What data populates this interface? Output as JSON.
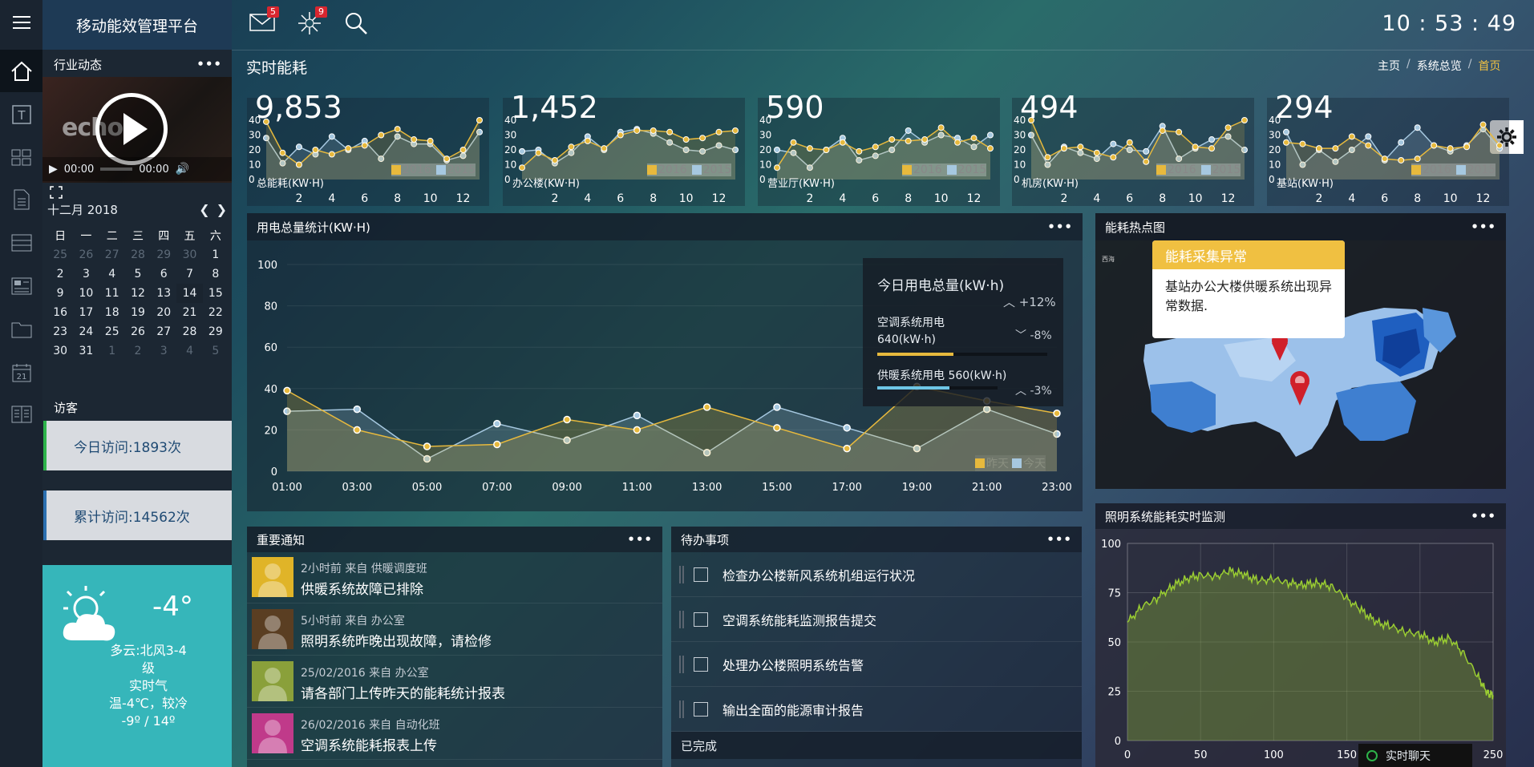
{
  "app": {
    "title": "移动能效管理平台",
    "clock": "10 : 53 : 49"
  },
  "topbar": {
    "mail_count": "5",
    "alert_count": "9"
  },
  "sidebar_icons": [
    "home-icon",
    "text-icon",
    "grid-icon",
    "document-icon",
    "inbox-icon",
    "layout-icon",
    "folder-icon",
    "calendar-icon",
    "columns-icon"
  ],
  "news": {
    "title": "行业动态",
    "more": "•••",
    "video_time": "00:00",
    "video_total": "00:00"
  },
  "calendar": {
    "month": "十二月 2018",
    "weekdays": [
      "日",
      "一",
      "二",
      "三",
      "四",
      "五",
      "六"
    ],
    "weeks": [
      [
        "25",
        "26",
        "27",
        "28",
        "29",
        "30",
        "1"
      ],
      [
        "2",
        "3",
        "4",
        "5",
        "6",
        "7",
        "8"
      ],
      [
        "9",
        "10",
        "11",
        "12",
        "13",
        "14",
        "15"
      ],
      [
        "16",
        "17",
        "18",
        "19",
        "20",
        "21",
        "22"
      ],
      [
        "23",
        "24",
        "25",
        "26",
        "27",
        "28",
        "29"
      ],
      [
        "30",
        "31",
        "1",
        "2",
        "3",
        "4",
        "5"
      ]
    ],
    "today": "14"
  },
  "visitors": {
    "title": "访客",
    "today": "今日访问:1893次",
    "total": "累计访问:14562次"
  },
  "weather": {
    "temp": "-4°",
    "desc": "多云:北风3-4级",
    "desc2": "实时气温-4℃，较冷",
    "range": "-9º / 14º"
  },
  "page": {
    "title": "实时能耗",
    "breadcrumb": [
      "主页",
      "系统总览",
      "首页"
    ]
  },
  "kpis": [
    {
      "value": "9,853",
      "label": "总能耗(KW·H)",
      "s2016": [
        39,
        18,
        10,
        20,
        17,
        21,
        23,
        30,
        34,
        27,
        26,
        14,
        20,
        40
      ],
      "s2015": [
        28,
        11,
        22,
        17,
        29,
        20,
        26,
        14,
        29,
        24,
        24,
        13,
        16,
        32
      ]
    },
    {
      "value": "1,452",
      "label": "办公楼(KW·H)",
      "s2016": [
        8,
        18,
        13,
        22,
        26,
        21,
        30,
        33,
        33,
        32,
        27,
        28,
        32,
        33
      ],
      "s2015": [
        19,
        20,
        11,
        18,
        29,
        20,
        32,
        34,
        31,
        25,
        20,
        19,
        23,
        20
      ]
    },
    {
      "value": "590",
      "label": "营业厅(KW·H)",
      "s2016": [
        8,
        25,
        21,
        20,
        25,
        19,
        22,
        27,
        26,
        27,
        35,
        25,
        28,
        21
      ],
      "s2015": [
        20,
        18,
        8,
        20,
        28,
        13,
        16,
        20,
        33,
        25,
        30,
        28,
        22,
        30
      ]
    },
    {
      "value": "494",
      "label": "机房(KW·H)",
      "s2016": [
        40,
        15,
        21,
        22,
        18,
        15,
        25,
        12,
        33,
        32,
        22,
        21,
        35,
        40
      ],
      "s2015": [
        30,
        10,
        22,
        18,
        14,
        24,
        20,
        19,
        36,
        14,
        21,
        27,
        29,
        20
      ]
    },
    {
      "value": "294",
      "label": "基站(KW·H)",
      "s2016": [
        25,
        24,
        21,
        21,
        29,
        23,
        14,
        13,
        14,
        23,
        21,
        22,
        37,
        23
      ],
      "s2015": [
        32,
        10,
        20,
        12,
        20,
        29,
        13,
        25,
        35,
        23,
        19,
        23,
        34,
        21
      ]
    }
  ],
  "kpi_legend": {
    "a": "2016",
    "b": "2015"
  },
  "kpi_axis": {
    "y": [
      "40",
      "30",
      "20",
      "10",
      "0"
    ],
    "x": [
      "2",
      "4",
      "6",
      "8",
      "10",
      "12"
    ]
  },
  "usage": {
    "title": "用电总量统计(KW·H)",
    "more": "•••",
    "summary_title": "今日用电总量(kW·h)",
    "summary_change": "+12%",
    "ac_label": "空调系统用电",
    "ac_value": "640(kW·h)",
    "ac_change": "-8%",
    "ac_progress": 0.45,
    "heat_label": "供暖系统用电 560(kW·h)",
    "heat_change": "-3%",
    "heat_progress": 0.6,
    "legend_a": "昨天",
    "legend_b": "今天"
  },
  "chart_data": [
    {
      "type": "area",
      "title": "用电总量统计(KW·H)",
      "x": [
        "01:00",
        "02:00",
        "03:00",
        "04:00",
        "05:00",
        "06:00",
        "07:00",
        "08:00",
        "09:00",
        "10:00",
        "11:00",
        "12:00",
        "13:00",
        "14:00",
        "15:00",
        "16:00",
        "17:00",
        "18:00",
        "19:00",
        "20:00",
        "21:00",
        "22:00",
        "23:00"
      ],
      "xticks": [
        "01:00",
        "03:00",
        "05:00",
        "07:00",
        "09:00",
        "11:00",
        "13:00",
        "15:00",
        "17:00",
        "19:00",
        "21:00",
        "23:00"
      ],
      "ylim": [
        0,
        100
      ],
      "yticks": [
        0,
        20,
        40,
        60,
        80,
        100
      ],
      "series": [
        {
          "name": "昨天",
          "color": "#e7b93d",
          "values": [
            39,
            null,
            20,
            null,
            12,
            null,
            13,
            null,
            25,
            null,
            20,
            null,
            31,
            null,
            21,
            null,
            11,
            null,
            41,
            null,
            34,
            null,
            28
          ]
        },
        {
          "name": "今天",
          "color": "#a6c8e0",
          "values": [
            29,
            null,
            30,
            null,
            6,
            null,
            23,
            null,
            15,
            null,
            27,
            null,
            9,
            null,
            31,
            null,
            21,
            null,
            11,
            null,
            30,
            null,
            18
          ]
        }
      ]
    },
    {
      "type": "area",
      "title": "照明系统能耗实时监测",
      "xlim": [
        0,
        250
      ],
      "ylim": [
        0,
        100
      ],
      "xticks": [
        0,
        50,
        100,
        150,
        200,
        250
      ],
      "yticks": [
        0,
        25,
        50,
        75,
        100
      ],
      "series": [
        {
          "name": "",
          "color": "#9acd32",
          "values": [
            [
              0,
              60
            ],
            [
              10,
              68
            ],
            [
              20,
              72
            ],
            [
              30,
              78
            ],
            [
              40,
              82
            ],
            [
              50,
              84
            ],
            [
              60,
              83
            ],
            [
              70,
              86
            ],
            [
              80,
              84
            ],
            [
              90,
              81
            ],
            [
              100,
              82
            ],
            [
              110,
              80
            ],
            [
              120,
              79
            ],
            [
              130,
              80
            ],
            [
              140,
              78
            ],
            [
              150,
              72
            ],
            [
              160,
              66
            ],
            [
              170,
              60
            ],
            [
              180,
              58
            ],
            [
              190,
              55
            ],
            [
              200,
              54
            ],
            [
              210,
              50
            ],
            [
              220,
              52
            ],
            [
              230,
              44
            ],
            [
              240,
              32
            ],
            [
              246,
              24
            ],
            [
              250,
              23
            ]
          ]
        }
      ]
    }
  ],
  "hotmap": {
    "title": "能耗热点图",
    "more": "•••",
    "popup_title": "能耗采集异常",
    "popup_text": "基站办公大楼供暖系统出现异常数据.",
    "corner": "西海"
  },
  "notices": {
    "title": "重要通知",
    "more": "•••",
    "items": [
      {
        "meta": "2小时前 来自 供暖调度班",
        "msg": "供暖系统故障已排除",
        "color": "#e0b428"
      },
      {
        "meta": "5小时前 来自 办公室",
        "msg": "照明系统昨晚出现故障，请检修",
        "color": "#5a3e22"
      },
      {
        "meta": "25/02/2016 来自 办公室",
        "msg": "请各部门上传昨天的能耗统计报表",
        "color": "#8aa03a"
      },
      {
        "meta": "26/02/2016 来自 自动化班",
        "msg": "空调系统能耗报表上传",
        "color": "#c03a8a"
      }
    ]
  },
  "todos": {
    "title": "待办事项",
    "more": "•••",
    "items": [
      "检查办公楼新风系统机组运行状况",
      "空调系统能耗监测报告提交",
      "处理办公楼照明系统告警",
      "输出全面的能源审计报告"
    ],
    "done": "已完成"
  },
  "lighting": {
    "title": "照明系统能耗实时监测",
    "more": "•••"
  },
  "chat": {
    "label": "实时聊天"
  }
}
